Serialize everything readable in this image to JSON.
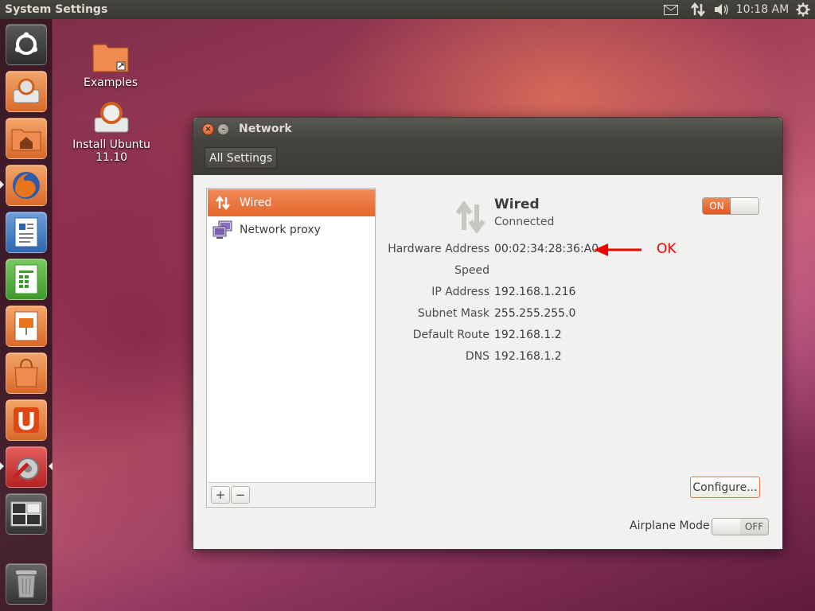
{
  "top_panel": {
    "app_title": "System Settings",
    "clock": "10:18 AM",
    "indicators": [
      "mail-icon",
      "network-icon",
      "volume-icon",
      "gear-icon"
    ]
  },
  "launcher": {
    "items": [
      "ubuntu-dash-icon",
      "installer-icon",
      "home-folder-icon",
      "firefox-icon",
      "writer-icon",
      "calc-icon",
      "impress-icon",
      "software-center-icon",
      "ubuntu-one-icon",
      "system-settings-icon",
      "workspace-switcher-icon",
      "trash-icon"
    ]
  },
  "desktop": {
    "icons": [
      {
        "label": "Examples"
      },
      {
        "label": "Install Ubuntu 11.10"
      }
    ]
  },
  "window": {
    "title": "Network",
    "toolbar": {
      "all_settings_label": "All Settings"
    },
    "list": {
      "items": [
        {
          "label": "Wired",
          "selected": true,
          "icon": "wired-icon"
        },
        {
          "label": "Network proxy",
          "selected": false,
          "icon": "network-proxy-icon"
        }
      ],
      "add_label": "+",
      "remove_label": "−"
    },
    "device": {
      "name": "Wired",
      "status": "Connected",
      "toggle": {
        "on_label": "ON",
        "state": "on"
      }
    },
    "details": [
      {
        "label": "Hardware Address",
        "value": "00:02:34:28:36:A0"
      },
      {
        "label": "Speed",
        "value": ""
      },
      {
        "label": "IP Address",
        "value": "192.168.1.216"
      },
      {
        "label": "Subnet Mask",
        "value": "255.255.255.0"
      },
      {
        "label": "Default Route",
        "value": "192.168.1.2"
      },
      {
        "label": "DNS",
        "value": "192.168.1.2"
      }
    ],
    "configure_label": "Configure...",
    "airplane_mode": {
      "label": "Airplane Mode",
      "off_label": "OFF",
      "state": "off"
    }
  },
  "annotation": {
    "text": "OK",
    "color": "#f00000"
  },
  "colors": {
    "accent": "#e4682e",
    "panel": "#3c3b37"
  }
}
